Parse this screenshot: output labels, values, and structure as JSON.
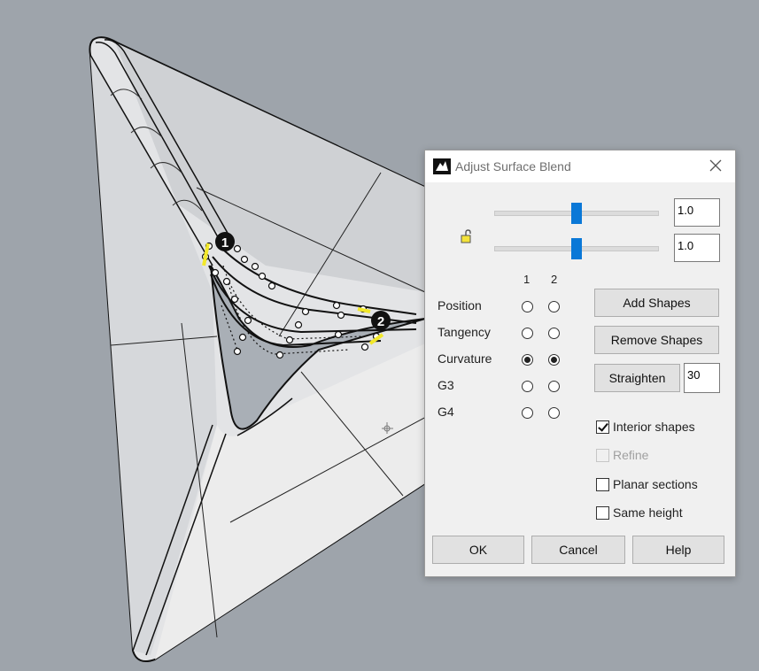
{
  "dialog": {
    "title": "Adjust Surface Blend",
    "icon": "rhino-icon",
    "sliders": [
      {
        "name": "blend-slider-1",
        "value": 1.0,
        "position": 0.5,
        "field_value": "1.0"
      },
      {
        "name": "blend-slider-2",
        "value": 1.0,
        "position": 0.5,
        "field_value": "1.0"
      }
    ],
    "lock_state": "unlocked",
    "columns": [
      "1",
      "2"
    ],
    "continuity": {
      "rows": [
        {
          "label": "Position",
          "selected": [
            false,
            false
          ]
        },
        {
          "label": "Tangency",
          "selected": [
            false,
            false
          ]
        },
        {
          "label": "Curvature",
          "selected": [
            true,
            true
          ]
        },
        {
          "label": "G3",
          "selected": [
            false,
            false
          ]
        },
        {
          "label": "G4",
          "selected": [
            false,
            false
          ]
        }
      ]
    },
    "buttons": {
      "add_shapes": "Add Shapes",
      "remove_shapes": "Remove Shapes",
      "straighten": "Straighten",
      "straighten_value": "30",
      "ok": "OK",
      "cancel": "Cancel",
      "help": "Help"
    },
    "options": [
      {
        "label": "Interior shapes",
        "checked": true,
        "enabled": true
      },
      {
        "label": "Refine",
        "checked": false,
        "enabled": false
      },
      {
        "label": "Planar sections",
        "checked": false,
        "enabled": true
      },
      {
        "label": "Same height",
        "checked": false,
        "enabled": true
      }
    ]
  },
  "viewport": {
    "markers": [
      "1",
      "2"
    ],
    "background": "#9ea4ab",
    "surface_color": "#e4e5e7",
    "accent_yellow": "#f2e82a"
  }
}
